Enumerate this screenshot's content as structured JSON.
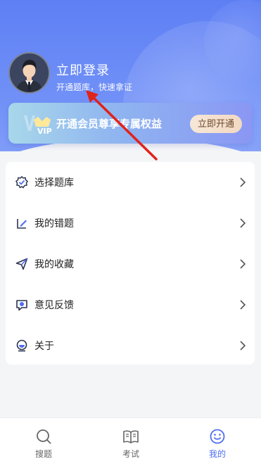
{
  "profile": {
    "login_title": "立即登录",
    "login_subtitle": "开通题库，快速拿证",
    "avatar_icon": "user-avatar-icon"
  },
  "vip": {
    "badge_text": "VIP",
    "promo_text": "开通会员尊享专属权益",
    "open_button": "立即开通"
  },
  "menu": {
    "items": [
      {
        "label": "选择题库",
        "icon": "badge-check-icon"
      },
      {
        "label": "我的错题",
        "icon": "edit-icon"
      },
      {
        "label": "我的收藏",
        "icon": "send-icon"
      },
      {
        "label": "意见反馈",
        "icon": "chat-icon"
      },
      {
        "label": "关于",
        "icon": "globe-icon"
      }
    ]
  },
  "tabs": [
    {
      "label": "搜题",
      "icon": "search-icon",
      "active": false
    },
    {
      "label": "考试",
      "icon": "book-icon",
      "active": false
    },
    {
      "label": "我的",
      "icon": "profile-icon",
      "active": true
    }
  ],
  "colors": {
    "accent": "#4f6df0",
    "header": "#6a8af6",
    "annotation_arrow": "#e0231b"
  }
}
